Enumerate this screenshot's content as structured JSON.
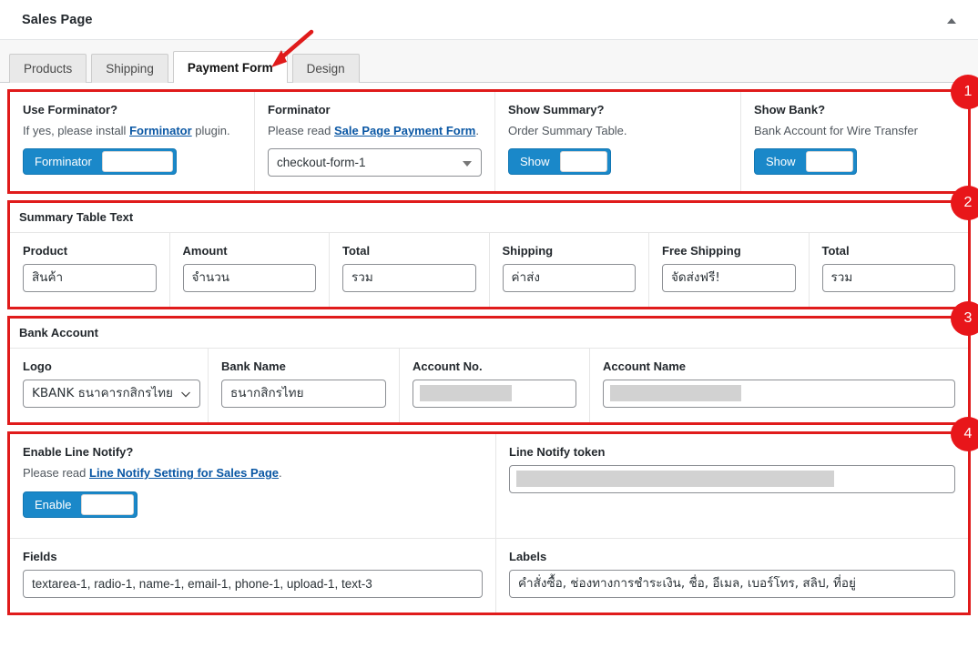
{
  "panel": {
    "title": "Sales Page",
    "collapse_icon": "caret-up-icon"
  },
  "tabs": [
    {
      "label": "Products",
      "active": false
    },
    {
      "label": "Shipping",
      "active": false
    },
    {
      "label": "Payment Form",
      "active": true
    },
    {
      "label": "Design",
      "active": false
    }
  ],
  "annotations": {
    "arrow_target": "Payment Form",
    "arrow_color": "#e01b1b",
    "badge_color": "#e8161a",
    "outline_color": "#e01b1b"
  },
  "sections": {
    "s1": {
      "badge": "1",
      "use_forminator": {
        "label": "Use Forminator?",
        "desc_before": "If yes, please install ",
        "desc_link": "Forminator",
        "desc_after": " plugin.",
        "toggle_label": "Forminator"
      },
      "forminator": {
        "label": "Forminator",
        "desc_before": "Please read ",
        "desc_link": "Sale Page Payment Form",
        "desc_after": ".",
        "select_value": "checkout-form-1"
      },
      "show_summary": {
        "label": "Show Summary?",
        "desc": "Order Summary Table.",
        "toggle_label": "Show"
      },
      "show_bank": {
        "label": "Show Bank?",
        "desc": "Bank Account for Wire Transfer",
        "toggle_label": "Show"
      }
    },
    "s2": {
      "badge": "2",
      "heading": "Summary Table Text",
      "fields": [
        {
          "label": "Product",
          "value": "สินค้า"
        },
        {
          "label": "Amount",
          "value": "จำนวน"
        },
        {
          "label": "Total",
          "value": "รวม"
        },
        {
          "label": "Shipping",
          "value": "ค่าส่ง"
        },
        {
          "label": "Free Shipping",
          "value": "จัดส่งฟรี!"
        },
        {
          "label": "Total",
          "value": "รวม"
        }
      ]
    },
    "s3": {
      "badge": "3",
      "heading": "Bank Account",
      "logo": {
        "label": "Logo",
        "value": "KBANK ธนาคารกสิกรไทย"
      },
      "bank_name": {
        "label": "Bank Name",
        "value": "ธนากสิกรไทย"
      },
      "account_no": {
        "label": "Account No.",
        "value": ""
      },
      "account_name": {
        "label": "Account Name",
        "value": ""
      }
    },
    "s4": {
      "badge": "4",
      "enable_line_notify": {
        "label": "Enable Line Notify?",
        "desc_before": "Please read ",
        "desc_link": "Line Notify Setting for Sales Page",
        "desc_after": ".",
        "toggle_label": "Enable"
      },
      "line_notify_token": {
        "label": "Line Notify token",
        "value": ""
      },
      "fields": {
        "label": "Fields",
        "value": "textarea-1, radio-1, name-1, email-1, phone-1, upload-1, text-3"
      },
      "labels": {
        "label": "Labels",
        "value": "คำสั่งซื้อ, ช่องทางการชำระเงิน, ชื่อ, อีเมล, เบอร์โทร, สลิป, ที่อยู่"
      }
    }
  }
}
